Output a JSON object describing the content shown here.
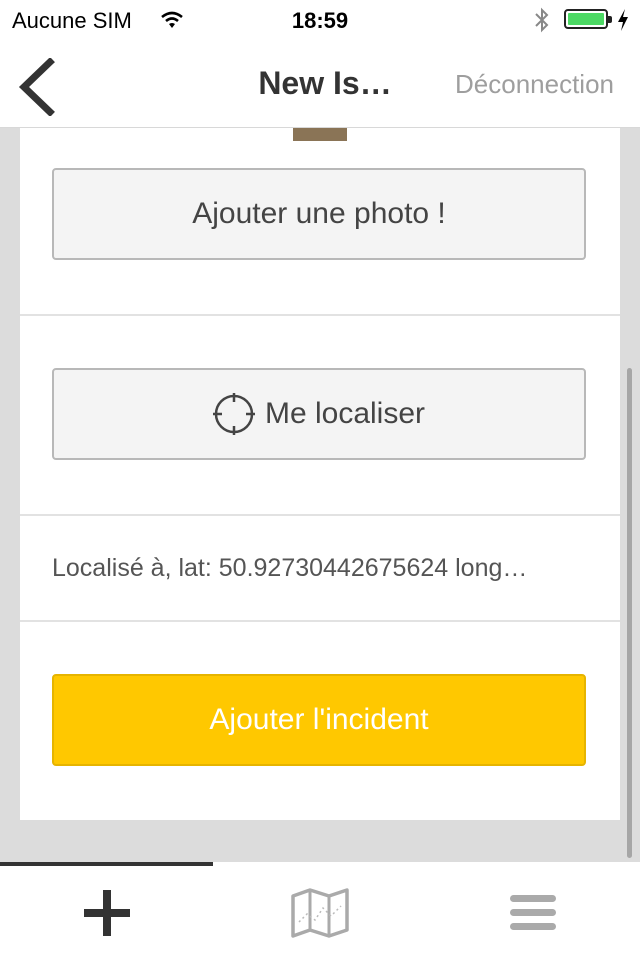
{
  "status_bar": {
    "carrier": "Aucune SIM",
    "time": "18:59",
    "battery_color": "#4cd964"
  },
  "navbar": {
    "back_icon": "chevron-left-icon",
    "title": "New Is…",
    "logout_label": "Déconnection"
  },
  "form": {
    "add_photo_label": "Ajouter une photo !",
    "locate_label": "Me localiser",
    "locate_icon": "crosshair-icon",
    "location_text": "Localisé à, lat: 50.92730442675624 long…",
    "submit_label": "Ajouter l'incident",
    "submit_color": "#ffc800"
  },
  "tabbar": {
    "tabs": [
      {
        "icon": "plus-icon",
        "active": true
      },
      {
        "icon": "map-icon",
        "active": false
      },
      {
        "icon": "menu-icon",
        "active": false
      }
    ]
  }
}
